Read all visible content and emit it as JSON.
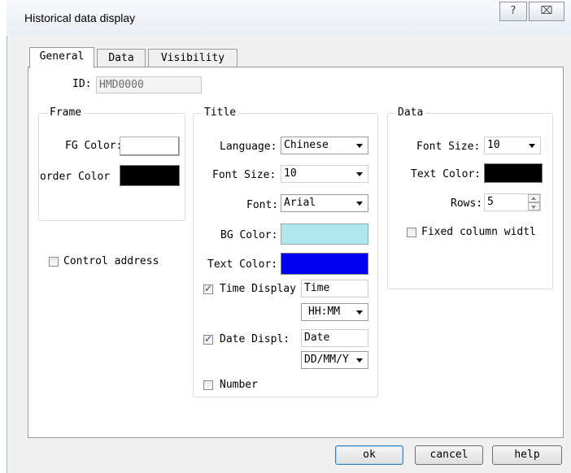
{
  "window": {
    "title": "Historical data display",
    "help_glyph": "?",
    "close_glyph": "⌧"
  },
  "tabs": [
    {
      "label": "General",
      "active": true
    },
    {
      "label": "Data",
      "active": false
    },
    {
      "label": "Visibility",
      "active": false
    }
  ],
  "id_field": {
    "label": "ID:",
    "value": "HMD0000"
  },
  "frame": {
    "legend": "Frame",
    "fg_label": "FG Color:",
    "border_label": "order Color",
    "fg_color": "#ffffff",
    "border_color": "#000000"
  },
  "control_address": {
    "label": "Control address",
    "checked": false
  },
  "title_group": {
    "legend": "Title",
    "language_label": "Language:",
    "language_value": "Chinese",
    "font_size_label": "Font Size:",
    "font_size_value": "10",
    "font_label": "Font:",
    "font_value": "Arial",
    "bg_label": "BG Color:",
    "bg_color": "#aee8ee",
    "text_color_label": "Text Color:",
    "text_color": "#0000f0",
    "time_display": {
      "label": "Time Display",
      "checked": true,
      "text": "Time",
      "format": "HH:MM"
    },
    "date_display": {
      "label": "Date Displ:",
      "checked": true,
      "text": "Date",
      "format": "DD/MM/Y"
    },
    "number": {
      "label": "Number",
      "checked": false
    }
  },
  "data_group": {
    "legend": "Data",
    "font_size_label": "Font Size:",
    "font_size_value": "10",
    "text_color_label": "Text Color:",
    "text_color": "#000000",
    "rows_label": "Rows:",
    "rows_value": "5",
    "fixed_width": {
      "label": "Fixed column widtl",
      "checked": false
    }
  },
  "buttons": {
    "ok": "ok",
    "cancel": "cancel",
    "help": "help"
  }
}
